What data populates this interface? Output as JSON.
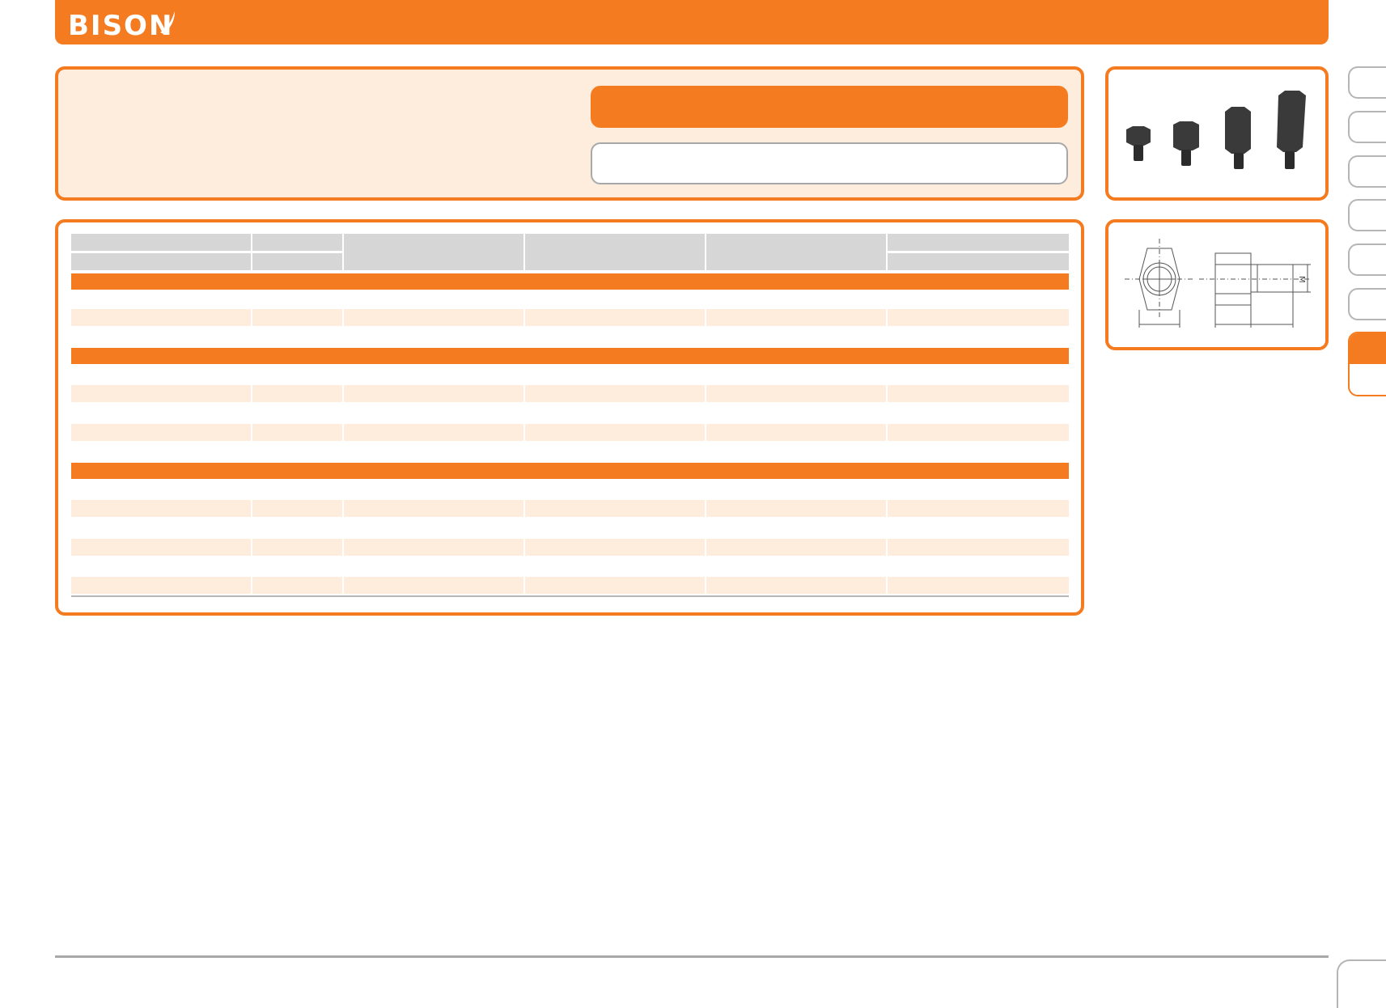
{
  "header": {
    "logo_text": "BISON",
    "brand_color": "#f47b20"
  },
  "drawing": {
    "thread_label": "M"
  },
  "table": {
    "sections": 3,
    "rows_per_section": [
      2,
      4,
      6
    ]
  },
  "colors": {
    "accent": "#f47b20",
    "row_tint": "#feecdd",
    "header_gray": "#d6d6d6"
  }
}
